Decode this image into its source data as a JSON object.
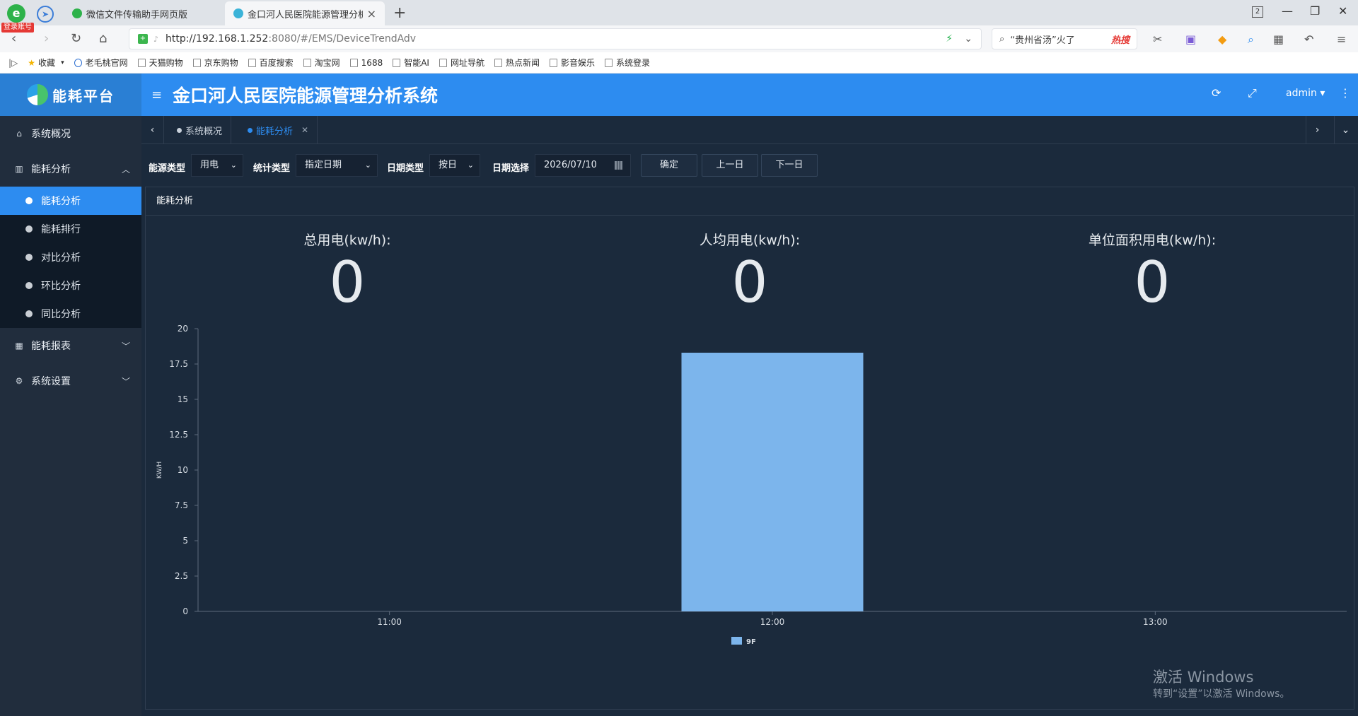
{
  "browser": {
    "login_badge": "登录账号",
    "tabs": [
      {
        "title": "微信文件传输助手网页版",
        "active": false
      },
      {
        "title": "金口河人民医院能源管理分析系",
        "active": true
      }
    ],
    "win_count": "2",
    "url_host": "http://192.168.1.252",
    "url_rest": ":8080/#/EMS/DeviceTrendAdv",
    "search_text": "“贵州省汤”火了",
    "search_hot": "热搜",
    "bookmarks_label": "收藏",
    "bookmarks": [
      "老毛桃官网",
      "天猫购物",
      "京东购物",
      "百度搜索",
      "淘宝网",
      "1688",
      "智能AI",
      "网址导航",
      "热点新闻",
      "影音娱乐",
      "系统登录"
    ]
  },
  "app": {
    "brand": "能耗平台",
    "title": "金口河人民医院能源管理分析系统",
    "user": "admin"
  },
  "sidebar": {
    "items": [
      {
        "label": "系统概况",
        "icon": "home-icon"
      },
      {
        "label": "能耗分析",
        "icon": "bar-chart-icon",
        "expanded": true,
        "children": [
          "能耗分析",
          "能耗排行",
          "对比分析",
          "环比分析",
          "同比分析"
        ]
      },
      {
        "label": "能耗报表",
        "icon": "table-icon"
      },
      {
        "label": "系统设置",
        "icon": "gear-icon"
      }
    ]
  },
  "tags": [
    {
      "label": "系统概况",
      "active": false
    },
    {
      "label": "能耗分析",
      "active": true
    }
  ],
  "filters": {
    "energy_type_label": "能源类型",
    "energy_type_value": "用电",
    "stat_type_label": "统计类型",
    "stat_type_value": "指定日期",
    "date_type_label": "日期类型",
    "date_type_value": "按日",
    "date_select_label": "日期选择",
    "date_value": "2026/07/10",
    "confirm": "确定",
    "prev_day": "上一日",
    "next_day": "下一日"
  },
  "panel": {
    "title": "能耗分析",
    "stats": [
      {
        "label": "总用电(kw/h):",
        "value": "0"
      },
      {
        "label": "人均用电(kw/h):",
        "value": "0"
      },
      {
        "label": "单位面积用电(kw/h):",
        "value": "0"
      }
    ]
  },
  "colors": {
    "accent": "#2d8cf0",
    "bar": "#7cb5ec",
    "bg": "#1b2a3c"
  },
  "chart_data": {
    "type": "bar",
    "categories": [
      "11:00",
      "12:00",
      "13:00"
    ],
    "series": [
      {
        "name": "9F",
        "values": [
          0,
          18.3,
          0
        ],
        "color": "#7cb5ec"
      }
    ],
    "ylabel": "KW/H",
    "ylim": [
      0,
      20
    ],
    "yticks": [
      "0",
      "2.5",
      "5",
      "7.5",
      "10",
      "12.5",
      "15",
      "17.5",
      "20"
    ],
    "legend": "bottom-center",
    "grid": false
  },
  "os_watermark": {
    "line1": "激活 Windows",
    "line2": "转到“设置”以激活 Windows。"
  }
}
